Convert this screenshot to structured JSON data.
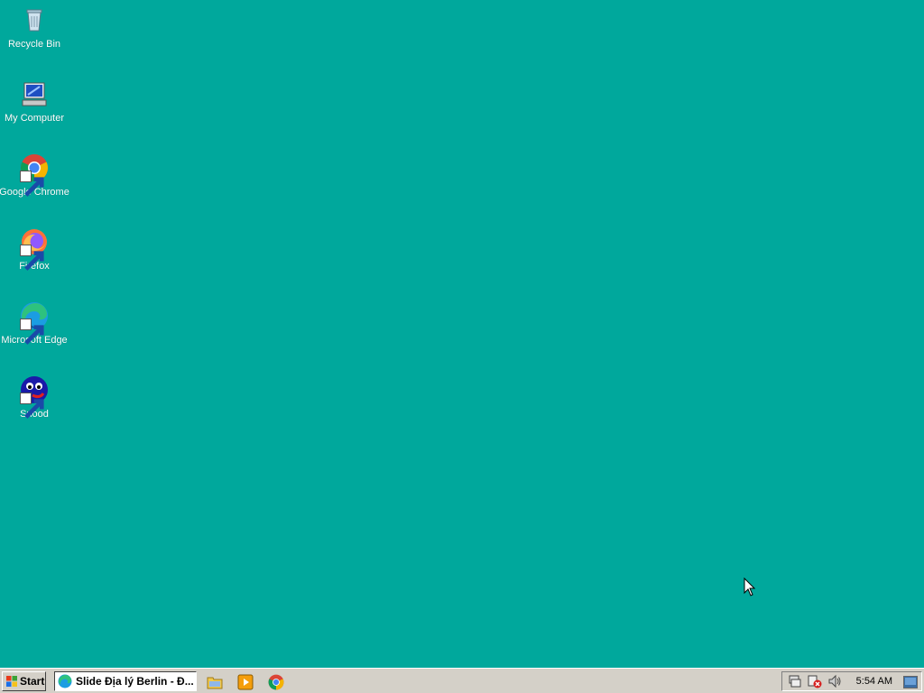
{
  "desktop": {
    "icons": [
      {
        "label": "Recycle Bin",
        "icon": "recycle-bin-icon"
      },
      {
        "label": "My Computer",
        "icon": "my-computer-icon"
      },
      {
        "label": "Google Chrome",
        "icon": "chrome-icon"
      },
      {
        "label": "Firefox",
        "icon": "firefox-icon"
      },
      {
        "label": "Microsoft Edge",
        "icon": "edge-icon"
      },
      {
        "label": "Snood",
        "icon": "snood-icon"
      }
    ],
    "background_color": "#00a89c"
  },
  "taskbar": {
    "start_label": "Start",
    "window_button": {
      "label": "Slide Địa lý Berlin - Đ...",
      "icon": "edge-icon"
    },
    "quick_launch": [
      {
        "icon": "folder-icon"
      },
      {
        "icon": "media-player-icon"
      },
      {
        "icon": "chrome-icon"
      }
    ],
    "tray": {
      "icons": [
        "network-icon",
        "security-alert-icon",
        "volume-icon"
      ],
      "clock": "5:54 AM"
    }
  }
}
